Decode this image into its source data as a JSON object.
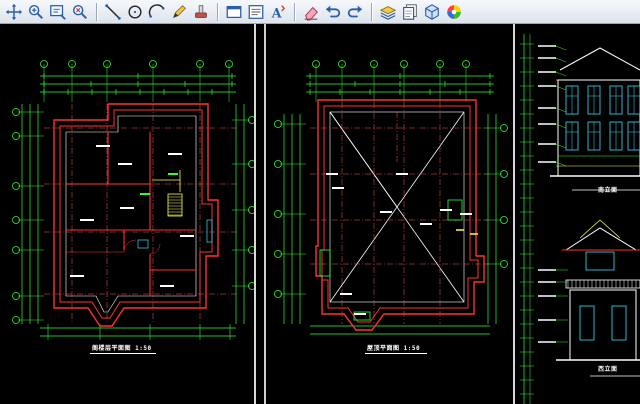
{
  "app": {
    "toolbar": {
      "groups": [
        [
          {
            "name": "zoom-pan-icon"
          },
          {
            "name": "zoom-in-icon"
          },
          {
            "name": "zoom-window-icon"
          },
          {
            "name": "zoom-realtime-icon"
          }
        ],
        [
          {
            "name": "line-icon"
          },
          {
            "name": "circle-icon"
          },
          {
            "name": "arc-icon"
          },
          {
            "name": "pencil-icon"
          },
          {
            "name": "stamp-icon"
          }
        ],
        [
          {
            "name": "rectangle-window-icon"
          },
          {
            "name": "text-box-icon"
          },
          {
            "name": "text-style-icon"
          }
        ],
        [
          {
            "name": "eraser-icon"
          },
          {
            "name": "undo-icon"
          },
          {
            "name": "redo-icon"
          }
        ],
        [
          {
            "name": "layers-icon"
          },
          {
            "name": "sheets-icon"
          },
          {
            "name": "3d-box-icon"
          },
          {
            "name": "color-wheel-icon"
          }
        ]
      ]
    }
  },
  "colors": {
    "background": "#000000",
    "wall": "#ff3030",
    "dimension": "#2cff2c",
    "axis": "#ff5555",
    "annotation": "#ffffff",
    "accent": "#ffff40",
    "window": "#30e0ff"
  },
  "drawings": [
    {
      "id": "plan-left",
      "caption": "阁楼层平面图 1:50"
    },
    {
      "id": "plan-middle",
      "caption": "屋顶平面图 1:50"
    },
    {
      "id": "elevation-right",
      "captions": [
        "南立面",
        "西立面"
      ]
    }
  ]
}
